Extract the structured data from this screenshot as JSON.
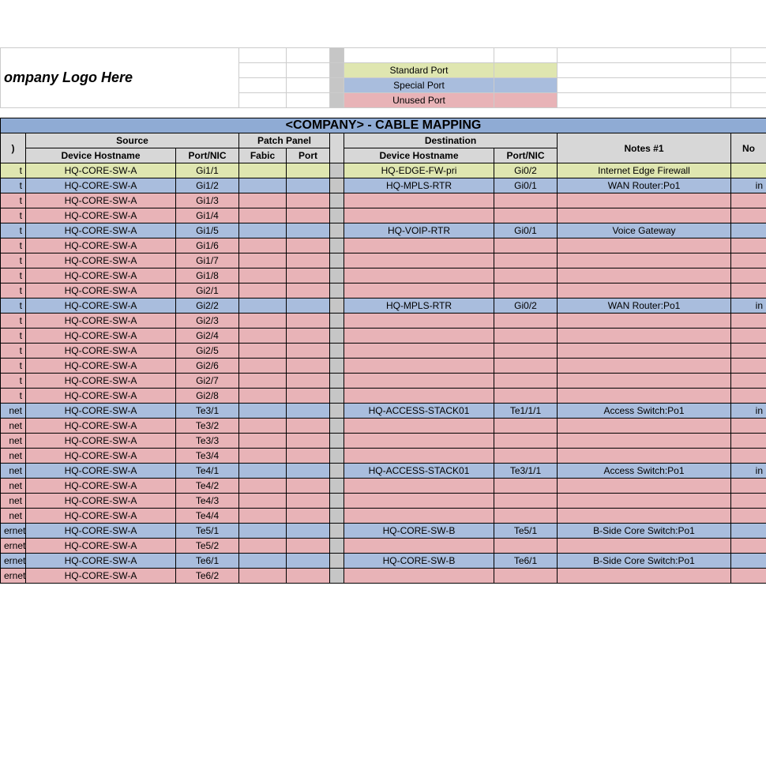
{
  "logo_placeholder": "ompany Logo Here",
  "legend": {
    "standard": "Standard Port",
    "special": "Special Port",
    "unused": "Unused Port"
  },
  "title": "<COMPANY> - CABLE MAPPING",
  "headers": {
    "col_a": ")",
    "source": "Source",
    "patch_panel": "Patch Panel",
    "destination": "Destination",
    "notes1": "Notes #1",
    "notes2": "No",
    "device_hostname": "Device Hostname",
    "port_nic": "Port/NIC",
    "fabic": "Fabic",
    "port": "Port"
  },
  "rows": [
    {
      "cls": "std",
      "a": "t",
      "host": "HQ-CORE-SW-A",
      "port": "Gi1/1",
      "dhost": "HQ-EDGE-FW-pri",
      "dport": "Gi0/2",
      "n1": "Internet Edge Firewall",
      "n2": ""
    },
    {
      "cls": "spc",
      "a": "t",
      "host": "HQ-CORE-SW-A",
      "port": "Gi1/2",
      "dhost": "HQ-MPLS-RTR",
      "dport": "Gi0/1",
      "n1": "WAN Router:Po1",
      "n2": "in"
    },
    {
      "cls": "unu",
      "a": "t",
      "host": "HQ-CORE-SW-A",
      "port": "Gi1/3",
      "dhost": "",
      "dport": "",
      "n1": "",
      "n2": ""
    },
    {
      "cls": "unu",
      "a": "t",
      "host": "HQ-CORE-SW-A",
      "port": "Gi1/4",
      "dhost": "",
      "dport": "",
      "n1": "",
      "n2": ""
    },
    {
      "cls": "spc",
      "a": "t",
      "host": "HQ-CORE-SW-A",
      "port": "Gi1/5",
      "dhost": "HQ-VOIP-RTR",
      "dport": "Gi0/1",
      "n1": "Voice Gateway",
      "n2": ""
    },
    {
      "cls": "unu",
      "a": "t",
      "host": "HQ-CORE-SW-A",
      "port": "Gi1/6",
      "dhost": "",
      "dport": "",
      "n1": "",
      "n2": ""
    },
    {
      "cls": "unu",
      "a": "t",
      "host": "HQ-CORE-SW-A",
      "port": "Gi1/7",
      "dhost": "",
      "dport": "",
      "n1": "",
      "n2": ""
    },
    {
      "cls": "unu",
      "a": "t",
      "host": "HQ-CORE-SW-A",
      "port": "Gi1/8",
      "dhost": "",
      "dport": "",
      "n1": "",
      "n2": ""
    },
    {
      "cls": "unu",
      "a": "t",
      "host": "HQ-CORE-SW-A",
      "port": "Gi2/1",
      "dhost": "",
      "dport": "",
      "n1": "",
      "n2": ""
    },
    {
      "cls": "spc",
      "a": "t",
      "host": "HQ-CORE-SW-A",
      "port": "Gi2/2",
      "dhost": "HQ-MPLS-RTR",
      "dport": "Gi0/2",
      "n1": "WAN Router:Po1",
      "n2": "in"
    },
    {
      "cls": "unu",
      "a": "t",
      "host": "HQ-CORE-SW-A",
      "port": "Gi2/3",
      "dhost": "",
      "dport": "",
      "n1": "",
      "n2": ""
    },
    {
      "cls": "unu",
      "a": "t",
      "host": "HQ-CORE-SW-A",
      "port": "Gi2/4",
      "dhost": "",
      "dport": "",
      "n1": "",
      "n2": ""
    },
    {
      "cls": "unu",
      "a": "t",
      "host": "HQ-CORE-SW-A",
      "port": "Gi2/5",
      "dhost": "",
      "dport": "",
      "n1": "",
      "n2": ""
    },
    {
      "cls": "unu",
      "a": "t",
      "host": "HQ-CORE-SW-A",
      "port": "Gi2/6",
      "dhost": "",
      "dport": "",
      "n1": "",
      "n2": ""
    },
    {
      "cls": "unu",
      "a": "t",
      "host": "HQ-CORE-SW-A",
      "port": "Gi2/7",
      "dhost": "",
      "dport": "",
      "n1": "",
      "n2": ""
    },
    {
      "cls": "unu",
      "a": "t",
      "host": "HQ-CORE-SW-A",
      "port": "Gi2/8",
      "dhost": "",
      "dport": "",
      "n1": "",
      "n2": ""
    },
    {
      "cls": "spc",
      "a": "net",
      "host": "HQ-CORE-SW-A",
      "port": "Te3/1",
      "dhost": "HQ-ACCESS-STACK01",
      "dport": "Te1/1/1",
      "n1": "Access Switch:Po1",
      "n2": "in"
    },
    {
      "cls": "unu",
      "a": "net",
      "host": "HQ-CORE-SW-A",
      "port": "Te3/2",
      "dhost": "",
      "dport": "",
      "n1": "",
      "n2": ""
    },
    {
      "cls": "unu",
      "a": "net",
      "host": "HQ-CORE-SW-A",
      "port": "Te3/3",
      "dhost": "",
      "dport": "",
      "n1": "",
      "n2": ""
    },
    {
      "cls": "unu",
      "a": "net",
      "host": "HQ-CORE-SW-A",
      "port": "Te3/4",
      "dhost": "",
      "dport": "",
      "n1": "",
      "n2": ""
    },
    {
      "cls": "spc",
      "a": "net",
      "host": "HQ-CORE-SW-A",
      "port": "Te4/1",
      "dhost": "HQ-ACCESS-STACK01",
      "dport": "Te3/1/1",
      "n1": "Access Switch:Po1",
      "n2": "in"
    },
    {
      "cls": "unu",
      "a": "net",
      "host": "HQ-CORE-SW-A",
      "port": "Te4/2",
      "dhost": "",
      "dport": "",
      "n1": "",
      "n2": ""
    },
    {
      "cls": "unu",
      "a": "net",
      "host": "HQ-CORE-SW-A",
      "port": "Te4/3",
      "dhost": "",
      "dport": "",
      "n1": "",
      "n2": ""
    },
    {
      "cls": "unu",
      "a": "net",
      "host": "HQ-CORE-SW-A",
      "port": "Te4/4",
      "dhost": "",
      "dport": "",
      "n1": "",
      "n2": ""
    },
    {
      "cls": "spc",
      "a": "ernet",
      "host": "HQ-CORE-SW-A",
      "port": "Te5/1",
      "dhost": "HQ-CORE-SW-B",
      "dport": "Te5/1",
      "n1": "B-Side Core Switch:Po1",
      "n2": ""
    },
    {
      "cls": "unu",
      "a": "ernet",
      "host": "HQ-CORE-SW-A",
      "port": "Te5/2",
      "dhost": "",
      "dport": "",
      "n1": "",
      "n2": ""
    },
    {
      "cls": "spc",
      "a": "ernet",
      "host": "HQ-CORE-SW-A",
      "port": "Te6/1",
      "dhost": "HQ-CORE-SW-B",
      "dport": "Te6/1",
      "n1": "B-Side Core Switch:Po1",
      "n2": ""
    },
    {
      "cls": "unu",
      "a": "ernet",
      "host": "HQ-CORE-SW-A",
      "port": "Te6/2",
      "dhost": "",
      "dport": "",
      "n1": "",
      "n2": ""
    }
  ]
}
